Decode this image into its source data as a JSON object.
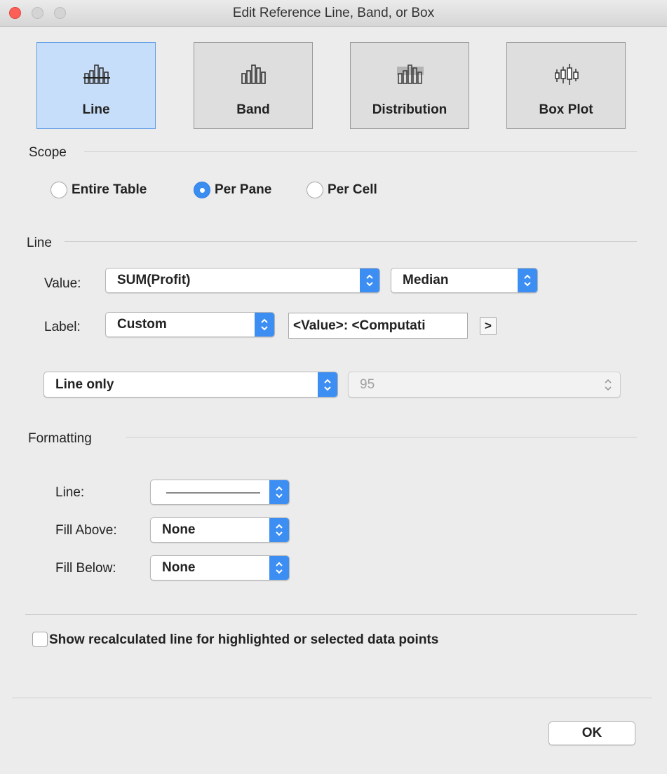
{
  "window": {
    "title": "Edit Reference Line, Band, or Box"
  },
  "types": [
    {
      "label": "Line",
      "icon": "reference-line-icon",
      "selected": true
    },
    {
      "label": "Band",
      "icon": "reference-band-icon",
      "selected": false
    },
    {
      "label": "Distribution",
      "icon": "distribution-icon",
      "selected": false
    },
    {
      "label": "Box Plot",
      "icon": "box-plot-icon",
      "selected": false
    }
  ],
  "scope": {
    "heading": "Scope",
    "options": [
      {
        "label": "Entire Table",
        "selected": false
      },
      {
        "label": "Per Pane",
        "selected": true
      },
      {
        "label": "Per Cell",
        "selected": false
      }
    ]
  },
  "line": {
    "heading": "Line",
    "value_label": "Value:",
    "value_field": "SUM(Profit)",
    "aggregation": "Median",
    "label_label": "Label:",
    "label_type": "Custom",
    "label_text": "<Value>: <Computati",
    "insert_button": ">",
    "display": "Line only",
    "confidence": "95"
  },
  "formatting": {
    "heading": "Formatting",
    "line_label": "Line:",
    "fill_above_label": "Fill Above:",
    "fill_above": "None",
    "fill_below_label": "Fill Below:",
    "fill_below": "None"
  },
  "recalculate": {
    "label": "Show recalculated line for highlighted or selected data points",
    "checked": false
  },
  "ok_label": "OK",
  "colors": {
    "accent": "#3c8ef3",
    "selected_bg": "#c6def9",
    "close": "#fc5f57"
  }
}
